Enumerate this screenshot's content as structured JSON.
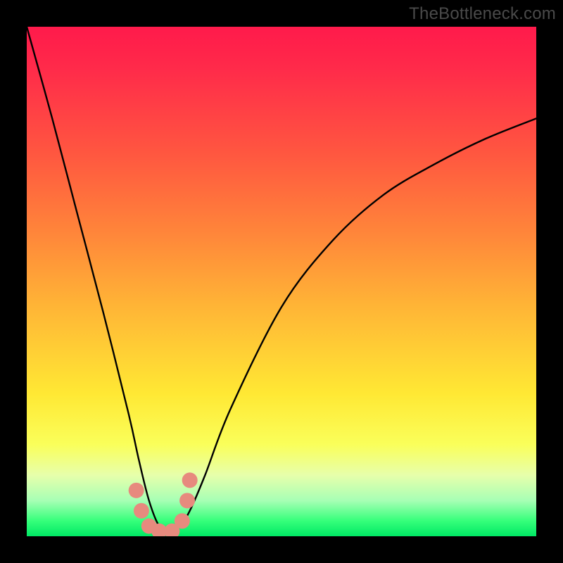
{
  "watermark": "TheBottleneck.com",
  "chart_data": {
    "type": "line",
    "title": "",
    "xlabel": "",
    "ylabel": "",
    "xlim": [
      0,
      100
    ],
    "ylim": [
      0,
      100
    ],
    "grid": false,
    "series": [
      {
        "name": "bottleneck-curve",
        "x": [
          0,
          5,
          10,
          15,
          20,
          22,
          24,
          26,
          28,
          30,
          32,
          35,
          40,
          50,
          60,
          70,
          80,
          90,
          100
        ],
        "y": [
          100,
          82,
          63,
          44,
          24,
          15,
          7,
          2,
          1,
          2,
          5,
          12,
          25,
          45,
          58,
          67,
          73,
          78,
          82
        ],
        "color": "#000000"
      }
    ],
    "markers": [
      {
        "name": "marker-left-upper",
        "x": 21.5,
        "y": 9,
        "color": "#e78a7e"
      },
      {
        "name": "marker-left-mid",
        "x": 22.5,
        "y": 5,
        "color": "#e78a7e"
      },
      {
        "name": "marker-left-low",
        "x": 24.0,
        "y": 2,
        "color": "#e78a7e"
      },
      {
        "name": "marker-bottom-1",
        "x": 26.0,
        "y": 1,
        "color": "#e78a7e"
      },
      {
        "name": "marker-bottom-2",
        "x": 28.5,
        "y": 1,
        "color": "#e78a7e"
      },
      {
        "name": "marker-right-low",
        "x": 30.5,
        "y": 3,
        "color": "#e78a7e"
      },
      {
        "name": "marker-right-mid",
        "x": 31.5,
        "y": 7,
        "color": "#e78a7e"
      },
      {
        "name": "marker-right-upper",
        "x": 32.0,
        "y": 11,
        "color": "#e78a7e"
      }
    ],
    "background_gradient": {
      "top": "#ff1a4b",
      "middle": "#ffe834",
      "bottom": "#00e865"
    }
  }
}
